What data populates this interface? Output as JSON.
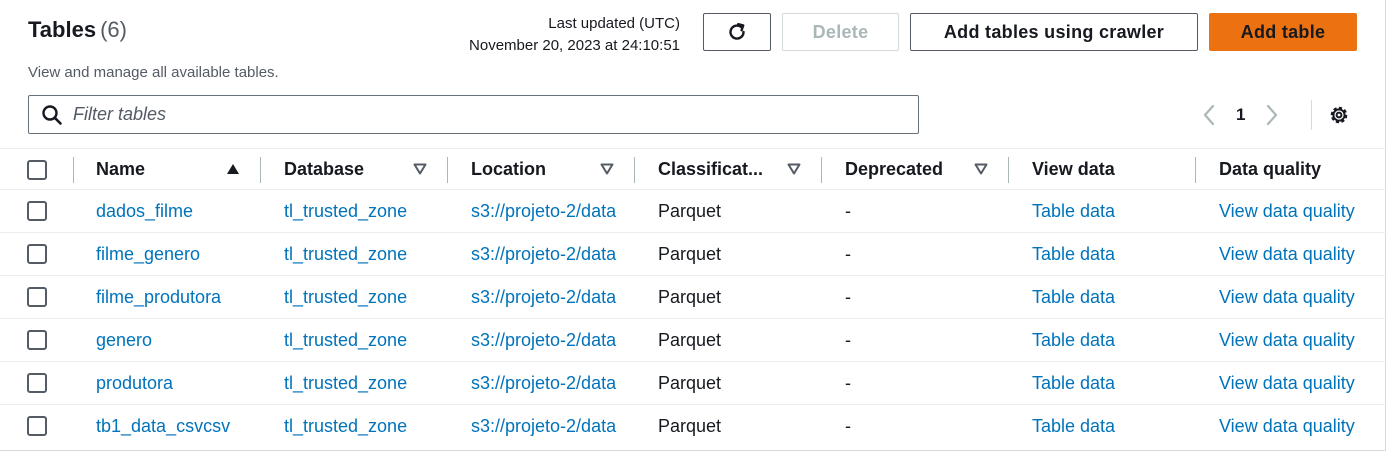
{
  "header": {
    "title": "Tables",
    "count": "(6)",
    "subtitle": "View and manage all available tables.",
    "last_updated_label": "Last updated (UTC)",
    "last_updated_value": "November 20, 2023 at 24:10:51"
  },
  "toolbar": {
    "refresh_icon": "refresh-icon",
    "delete_label": "Delete",
    "crawler_label": "Add tables using crawler",
    "add_label": "Add table",
    "accent_color": "#ec7211"
  },
  "search": {
    "placeholder": "Filter tables",
    "value": ""
  },
  "pagination": {
    "current_page": "1"
  },
  "table": {
    "columns": [
      "Name",
      "Database",
      "Location",
      "Classificat...",
      "Deprecated",
      "View data",
      "Data quality"
    ],
    "rows": [
      {
        "name": "dados_filme",
        "database": "tl_trusted_zone",
        "location": "s3://projeto-2/data",
        "classification": "Parquet",
        "deprecated": "-",
        "view_data": "Table data",
        "data_quality": "View data quality"
      },
      {
        "name": "filme_genero",
        "database": "tl_trusted_zone",
        "location": "s3://projeto-2/data",
        "classification": "Parquet",
        "deprecated": "-",
        "view_data": "Table data",
        "data_quality": "View data quality"
      },
      {
        "name": "filme_produtora",
        "database": "tl_trusted_zone",
        "location": "s3://projeto-2/data",
        "classification": "Parquet",
        "deprecated": "-",
        "view_data": "Table data",
        "data_quality": "View data quality"
      },
      {
        "name": "genero",
        "database": "tl_trusted_zone",
        "location": "s3://projeto-2/data",
        "classification": "Parquet",
        "deprecated": "-",
        "view_data": "Table data",
        "data_quality": "View data quality"
      },
      {
        "name": "produtora",
        "database": "tl_trusted_zone",
        "location": "s3://projeto-2/data",
        "classification": "Parquet",
        "deprecated": "-",
        "view_data": "Table data",
        "data_quality": "View data quality"
      },
      {
        "name": "tb1_data_csvcsv",
        "database": "tl_trusted_zone",
        "location": "s3://projeto-2/data",
        "classification": "Parquet",
        "deprecated": "-",
        "view_data": "Table data",
        "data_quality": "View data quality"
      }
    ]
  }
}
